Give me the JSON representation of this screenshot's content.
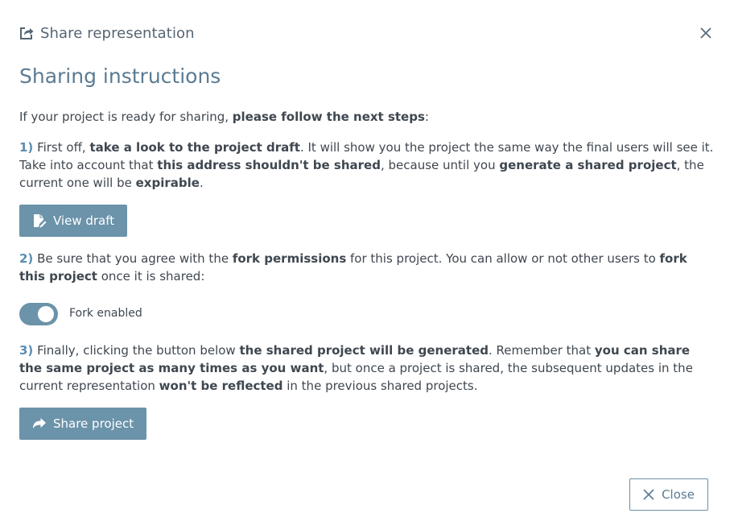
{
  "modal": {
    "title": "Share representation",
    "title_icon": "share-external-icon",
    "close_icon": "close-icon"
  },
  "heading": "Sharing instructions",
  "intro": {
    "text_1": "If your project is ready for sharing, ",
    "bold_1": "please follow the next steps",
    "text_2": ":"
  },
  "step1": {
    "num": "1)",
    "t1": " First off, ",
    "b1": "take a look to the project draft",
    "t2": ". It will show you the project the same way the final users will see it. Take into account that ",
    "b2": "this address shouldn't be shared",
    "t3": ", because until you ",
    "b3": "generate a shared project",
    "t4": ", the current one will be ",
    "b4": "expirable",
    "t5": ".",
    "button_label": "View draft",
    "button_icon": "edit-document-icon"
  },
  "step2": {
    "num": "2)",
    "t1": " Be sure that you agree with the ",
    "b1": "fork permissions",
    "t2": " for this project. You can allow or not other users to ",
    "b2": "fork this project",
    "t3": " once it is shared:",
    "toggle_label": "Fork enabled",
    "toggle_on": true
  },
  "step3": {
    "num": "3)",
    "t1": " Finally, clicking the button below ",
    "b1": "the shared project will be generated",
    "t2": ". Remember that ",
    "b2": "you can share the same project as many times as you want",
    "t3": ", but once a project is shared, the subsequent updates in the current representation ",
    "b3": "won't be reflected",
    "t4": " in the previous shared projects.",
    "button_label": "Share project",
    "button_icon": "share-arrow-icon"
  },
  "footer": {
    "close_label": "Close",
    "close_icon": "close-icon"
  },
  "colors": {
    "accent": "#6b93a9",
    "heading": "#5b7b93",
    "step_number": "#5b8db1",
    "text": "#3f4750"
  }
}
